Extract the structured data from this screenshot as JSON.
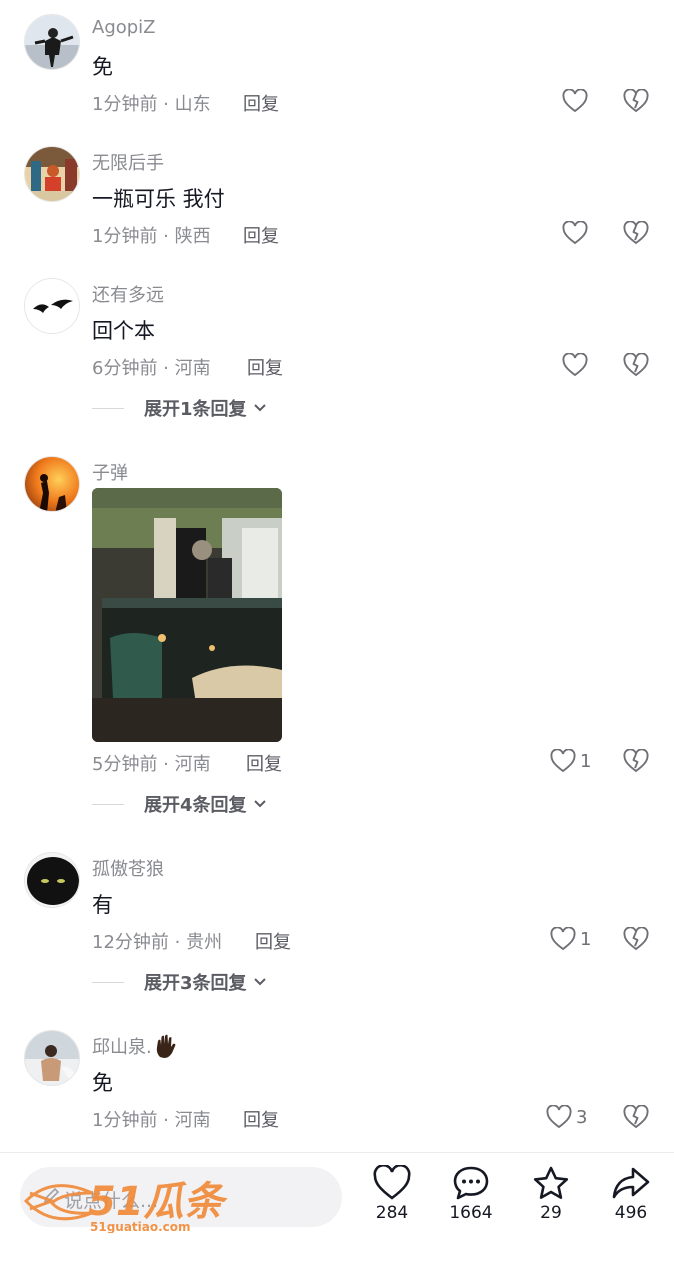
{
  "comments": [
    {
      "name": "AgopiZ",
      "text": "免",
      "time": "1分钟前",
      "location": "山东",
      "reply": "回复"
    },
    {
      "name": "无限后手",
      "text": "一瓶可乐 我付",
      "time": "1分钟前",
      "location": "陕西",
      "reply": "回复"
    },
    {
      "name": "还有多远",
      "text": "回个本",
      "time": "6分钟前",
      "location": "河南",
      "reply": "回复",
      "expand": "展开1条回复"
    },
    {
      "name": "子弹",
      "text": "",
      "time": "5分钟前",
      "location": "河南",
      "reply": "回复",
      "likes": "1",
      "expand": "展开4条回复"
    },
    {
      "name": "孤傲苍狼",
      "text": "有",
      "time": "12分钟前",
      "location": "贵州",
      "reply": "回复",
      "likes": "1",
      "expand": "展开3条回复"
    },
    {
      "name": "邱山泉.",
      "text": "免",
      "time": "1分钟前",
      "location": "河南",
      "reply": "回复",
      "likes": "3"
    }
  ],
  "meta_separator": " · ",
  "bottom_bar": {
    "placeholder": "说点什么...",
    "likes": "284",
    "comments": "1664",
    "favorites": "29",
    "shares": "496"
  },
  "watermark": {
    "brand": "51瓜条",
    "url": "51guatiao.com"
  },
  "colors": {
    "accent_watermark": "#f08a3a",
    "text_primary": "#161823",
    "text_secondary": "#8a8b91"
  },
  "icons": [
    "heart-icon",
    "broken-heart-icon",
    "chevron-down-icon",
    "chat-bubble-icon",
    "star-icon",
    "share-arrow-icon",
    "wave-hand-emoji"
  ]
}
